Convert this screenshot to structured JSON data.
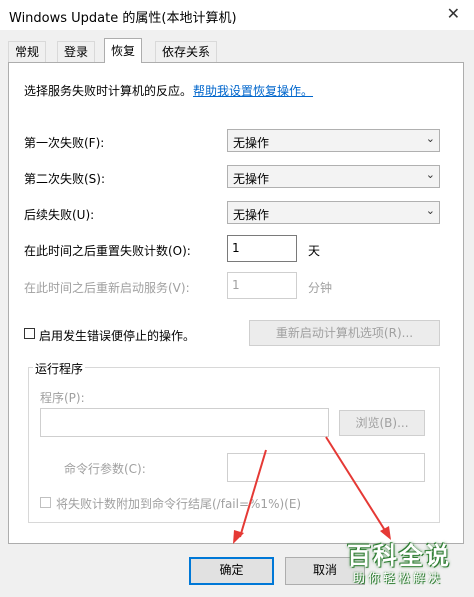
{
  "window": {
    "title": "Windows Update 的属性(本地计算机)",
    "close_glyph": "✕"
  },
  "tabs": [
    {
      "label": "常规"
    },
    {
      "label": "登录"
    },
    {
      "label": "恢复"
    },
    {
      "label": "依存关系"
    }
  ],
  "recovery": {
    "intro_text": "选择服务失败时计算机的反应。",
    "help_link": "帮助我设置恢复操作。",
    "first_failure": {
      "label": "第一次失败(F):",
      "value": "无操作"
    },
    "second_failure": {
      "label": "第二次失败(S):",
      "value": "无操作"
    },
    "subsequent_failure": {
      "label": "后续失败(U):",
      "value": "无操作"
    },
    "reset_count": {
      "label": "在此时间之后重置失败计数(O):",
      "value": "1",
      "unit": "天"
    },
    "restart_service": {
      "label": "在此时间之后重新启动服务(V):",
      "value": "1",
      "unit": "分钟"
    },
    "enable_stop_errors": {
      "label": "启用发生错误便停止的操作。",
      "checked": false
    },
    "restart_options_button": "重新启动计算机选项(R)...",
    "run_program": {
      "group_title": "运行程序",
      "program_label": "程序(P):",
      "program_value": "",
      "browse_button": "浏览(B)...",
      "params_label": "命令行参数(C):",
      "params_value": "",
      "append_fail_count": {
        "label": "将失败计数附加到命令行结尾(/fail=%1%)(E)",
        "checked": false
      }
    }
  },
  "footer": {
    "ok_label": "确定",
    "cancel_label": "取消"
  },
  "watermark": {
    "line1": "百科全说",
    "line2": "助你轻松解决"
  },
  "icons": {
    "dropdown": "chevron-down-icon"
  },
  "colors": {
    "link": "#0066cc",
    "primary_border": "#0078d7",
    "annotation_arrow": "#e53935"
  }
}
